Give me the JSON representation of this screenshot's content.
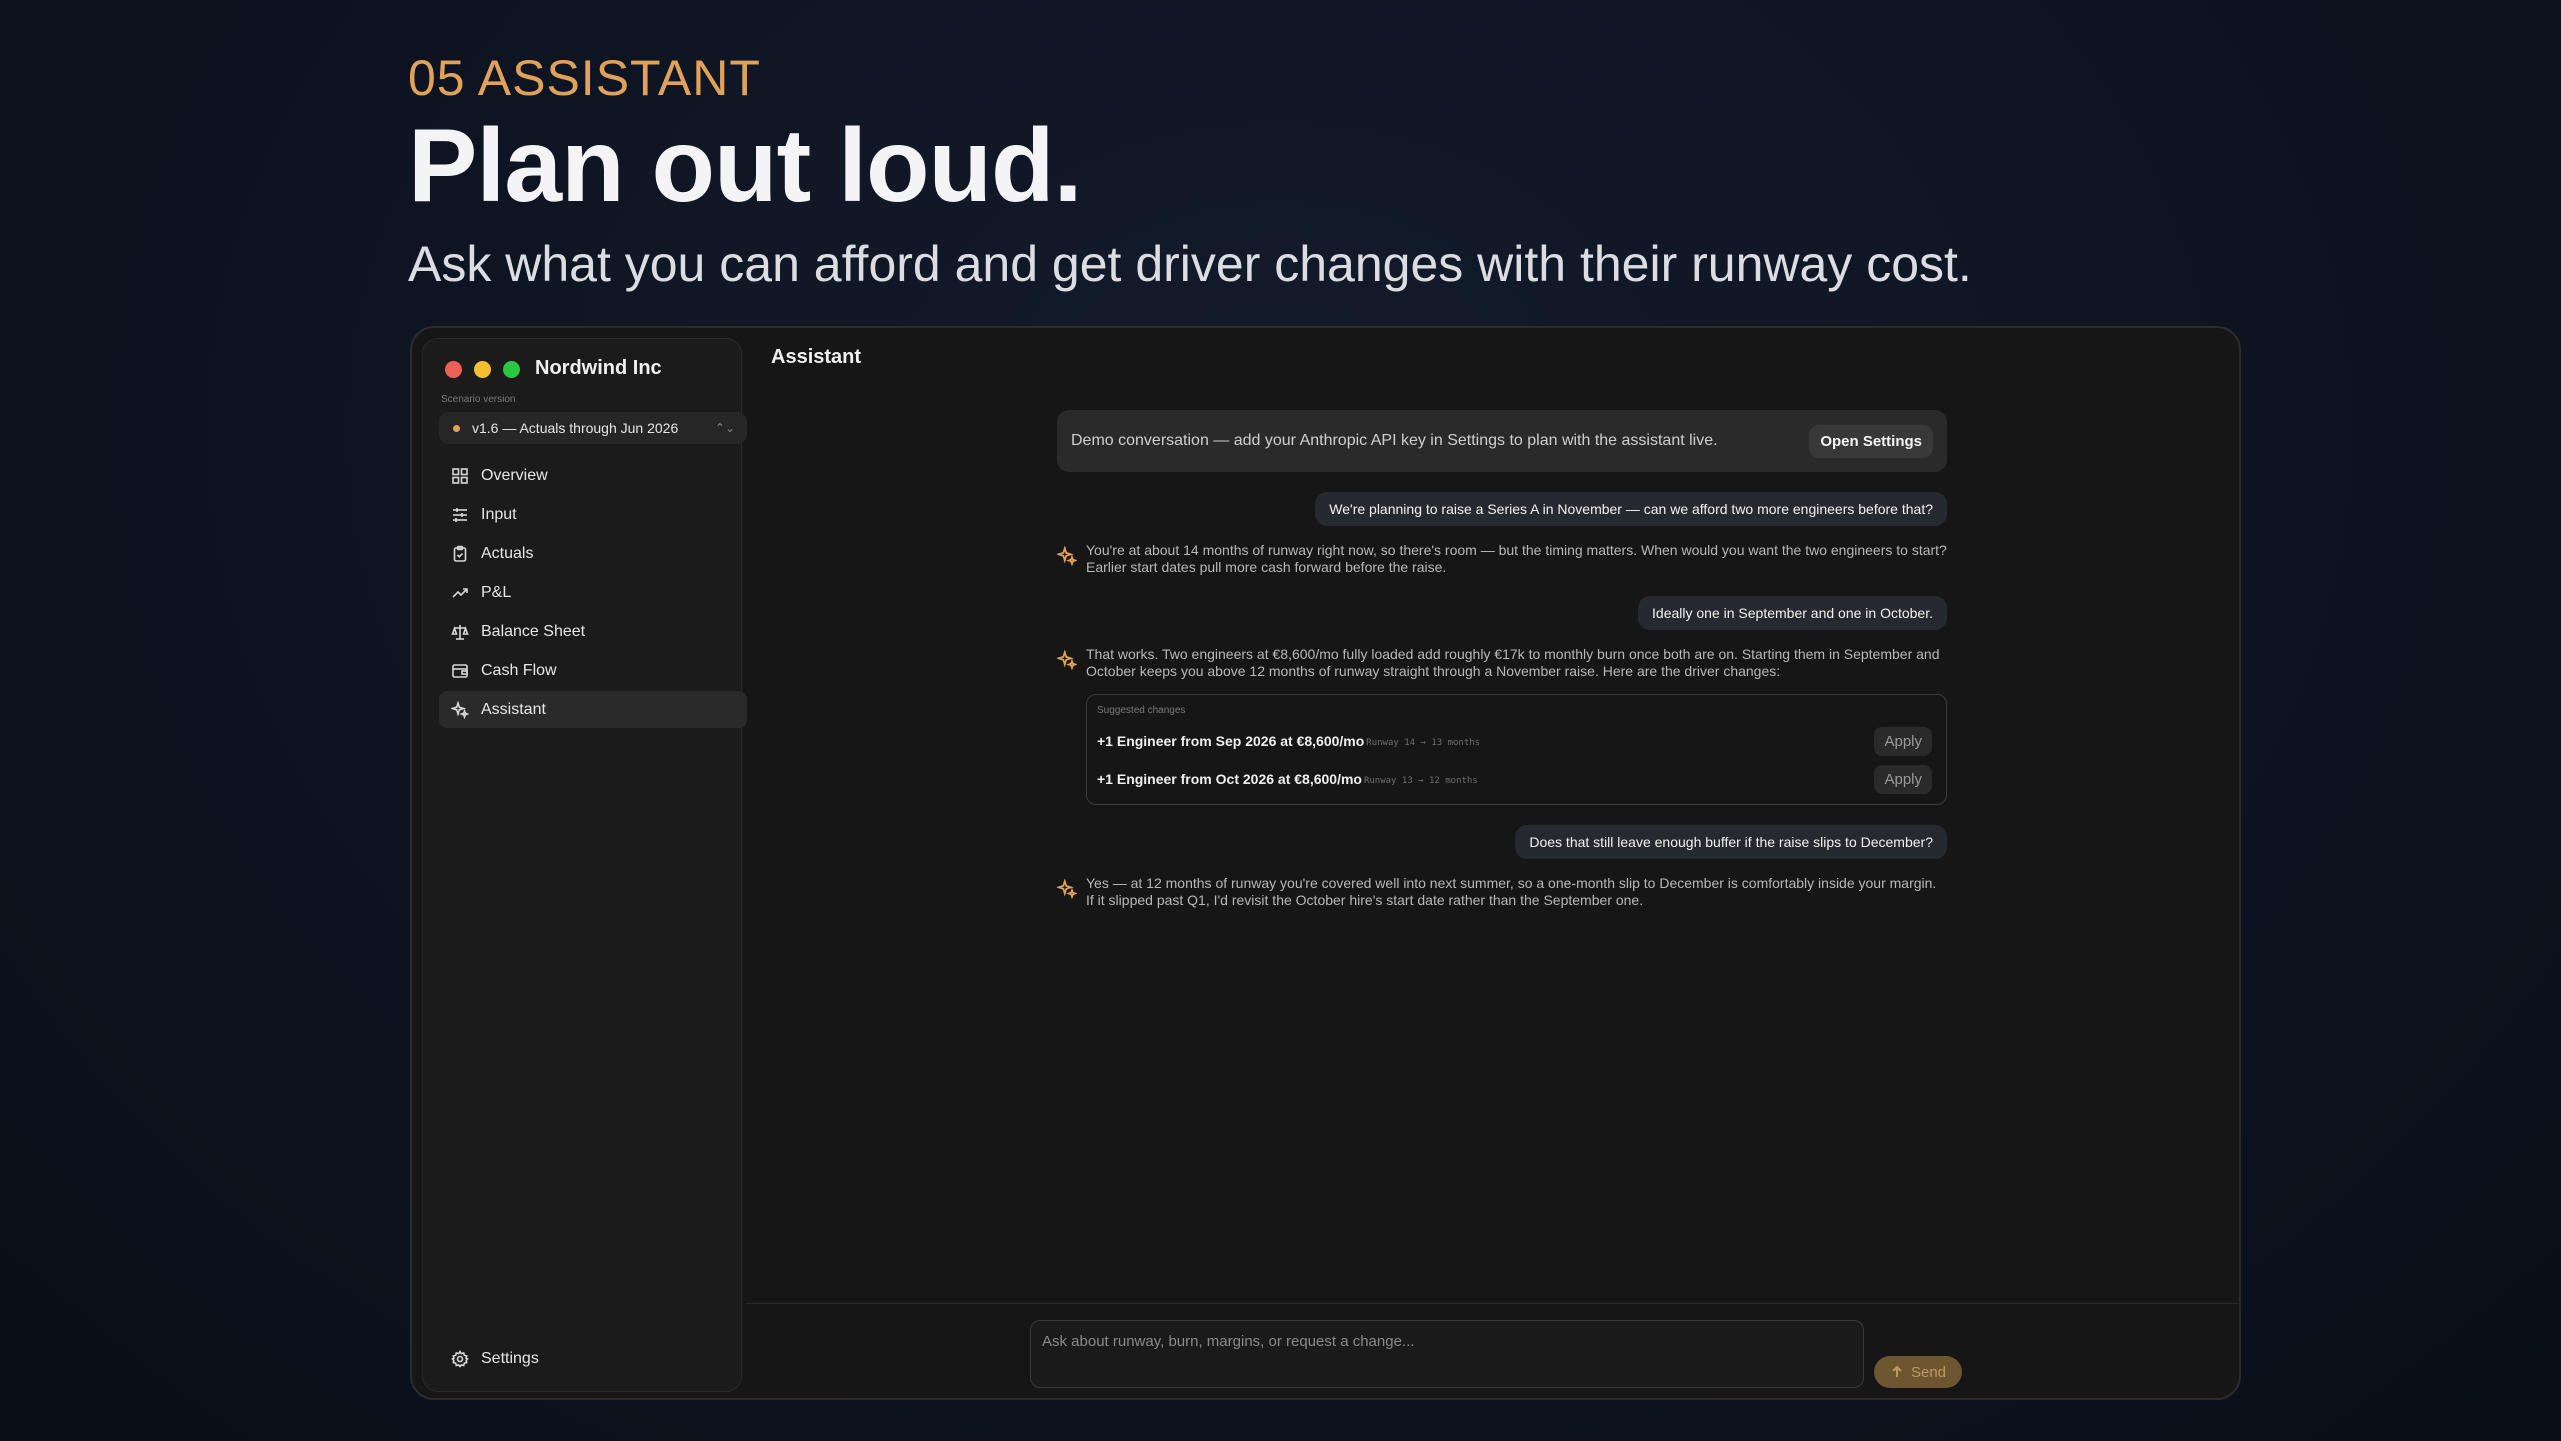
{
  "hero": {
    "eyebrow": "05 ASSISTANT",
    "headline": "Plan out loud.",
    "subhead": "Ask what you can afford and get driver changes with their runway cost."
  },
  "app": {
    "company": "Nordwind Inc",
    "scenario_label": "Scenario version",
    "scenario_value": "v1.6 — Actuals through Jun 2026",
    "nav": [
      {
        "label": "Overview",
        "icon": "grid-icon"
      },
      {
        "label": "Input",
        "icon": "sliders-icon"
      },
      {
        "label": "Actuals",
        "icon": "clipboard-check-icon"
      },
      {
        "label": "P&L",
        "icon": "trend-up-icon"
      },
      {
        "label": "Balance Sheet",
        "icon": "scale-icon"
      },
      {
        "label": "Cash Flow",
        "icon": "wallet-icon"
      },
      {
        "label": "Assistant",
        "icon": "sparkles-icon",
        "active": true
      }
    ],
    "settings_label": "Settings",
    "main_title": "Assistant"
  },
  "chat": {
    "banner_text": "Demo conversation — add your Anthropic API key in Settings to plan with the assistant live.",
    "banner_button": "Open Settings",
    "messages": {
      "u1": "We're planning to raise a Series A in November — can we afford two more engineers before that?",
      "a1": "You're at about 14 months of runway right now, so there's room — but the timing matters. When would you want the two engineers to start? Earlier start dates pull more cash forward before the raise.",
      "u2": "Ideally one in September and one in October.",
      "a2": "That works. Two engineers at €8,600/mo fully loaded add roughly €17k to monthly burn once both are on. Starting them in September and October keeps you above 12 months of runway straight through a November raise. Here are the driver changes:",
      "u3": "Does that still leave enough buffer if the raise slips to December?",
      "a3": "Yes — at 12 months of runway you're covered well into next summer, so a one-month slip to December is comfortably inside your margin. If it slipped past Q1, I'd revisit the October hire's start date rather than the September one."
    },
    "suggested": {
      "title": "Suggested changes",
      "items": [
        {
          "label": "+1 Engineer from Sep 2026 at €8,600/mo",
          "meta": "Runway 14 → 13 months",
          "button": "Apply"
        },
        {
          "label": "+1 Engineer from Oct 2026 at €8,600/mo",
          "meta": "Runway 13 → 12 months",
          "button": "Apply"
        }
      ]
    },
    "input_placeholder": "Ask about runway, burn, margins, or request a change...",
    "send_label": "Send"
  },
  "colors": {
    "accent": "#e0a25a",
    "background": "#0d1320",
    "window": "#161616"
  }
}
